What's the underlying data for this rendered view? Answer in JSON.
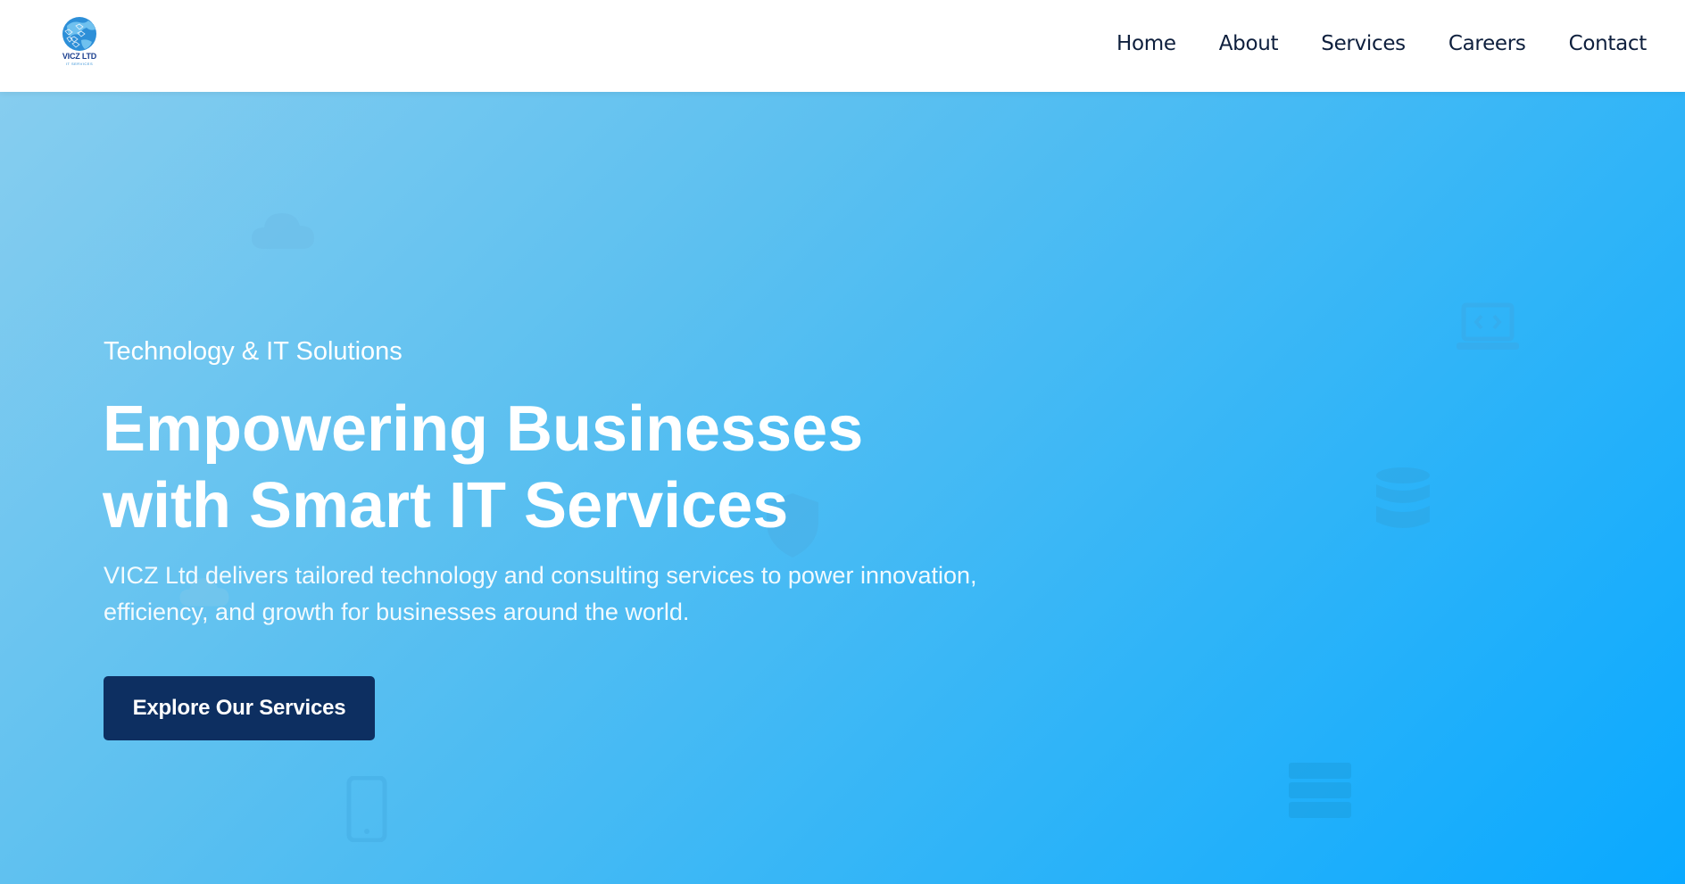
{
  "header": {
    "logo": {
      "text": "VICZ LTD",
      "subtext": "IT SERVICES",
      "icon": "globe-logo-icon"
    },
    "nav": [
      {
        "label": "Home"
      },
      {
        "label": "About"
      },
      {
        "label": "Services"
      },
      {
        "label": "Careers"
      },
      {
        "label": "Contact"
      }
    ]
  },
  "hero": {
    "kicker": "Technology & IT Solutions",
    "headline_line1": "Empowering Businesses",
    "headline_line2": "with Smart IT Services",
    "description": "VICZ Ltd delivers tailored technology and consulting services to power innovation, efficiency, and growth for businesses around the world.",
    "cta_label": "Explore Our Services",
    "background_icons": [
      "cloud-icon",
      "laptop-code-icon",
      "shield-icon",
      "database-icon",
      "server-icon",
      "smartphone-icon",
      "cloud-icon"
    ]
  },
  "colors": {
    "header_bg": "#ffffff",
    "nav_text": "#0e1f3d",
    "hero_gradient_start": "#86cdef",
    "hero_gradient_end": "#0aa9ff",
    "cta_bg": "#0d2f61",
    "hero_text": "#ffffff"
  }
}
